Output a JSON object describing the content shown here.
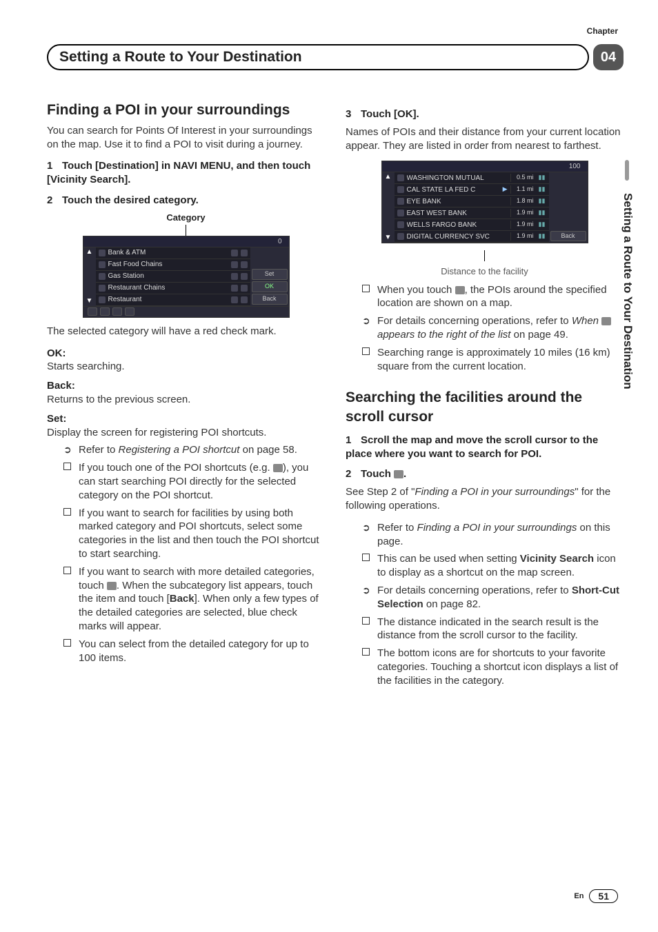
{
  "meta": {
    "chapter_label": "Chapter",
    "chapter_num": "04",
    "header_title": "Setting a Route to Your Destination",
    "side_text": "Setting a Route to Your Destination",
    "page_lang": "En",
    "page_num": "51"
  },
  "left": {
    "section_h": "Finding a POI in your surroundings",
    "intro": "You can search for Points Of Interest in your surroundings on the map. Use it to find a POI to visit during a journey.",
    "step1": "Touch [Destination] in NAVI MENU, and then touch [Vicinity Search].",
    "step2": "Touch the desired category.",
    "category_caption": "Category",
    "after_img": "The selected category will have a red check mark.",
    "ok_t": "OK:",
    "ok_b": "Starts searching.",
    "back_t": "Back:",
    "back_b": "Returns to the previous screen.",
    "set_t": "Set:",
    "set_b": "Display the screen for registering POI shortcuts.",
    "b_refer_pre": "Refer to ",
    "b_refer_em": "Registering a POI shortcut",
    "b_refer_post": " on page 58.",
    "b_ifshort": "If you touch one of the POI shortcuts (e.g. ",
    "b_ifshort2": "), you can start searching POI directly for the selected category on the POI shortcut.",
    "b_both": "If you want to search for facilities by using both marked category and POI shortcuts, select some categories in the list and then touch the POI shortcut to start searching.",
    "b_detail1": "If you want to search with more detailed categories, touch ",
    "b_detail2": ". When the subcategory list appears, touch the item and touch [",
    "b_detail_back": "Back",
    "b_detail3": "]. When only a few types of the detailed categories are selected, blue check marks will appear.",
    "b_100": "You can select from the detailed category for up to 100 items."
  },
  "right": {
    "step3": "Touch [OK].",
    "step3_body": "Names of POIs and their distance from your current location appear. They are listed in order from nearest to farthest.",
    "dist_caption": "Distance to the facility",
    "b_poi_map1": "When you touch ",
    "b_poi_map2": ", the POIs around the specified location are shown on a map.",
    "b_ops1": "For details concerning operations, refer to ",
    "b_ops_em": "When ",
    "b_ops_em2": " appears to the right of the list",
    "b_ops2": " on page 49.",
    "b_range": "Searching range is approximately 10 miles (16 km) square from the current location.",
    "section2_h": "Searching the facilities around the scroll cursor",
    "s2_step1": "Scroll the map and move the scroll cursor to the place where you want to search for POI.",
    "s2_step2": "Touch ",
    "s2_step2_post": ".",
    "s2_see1": "See Step 2 of \"",
    "s2_see_em": "Finding a POI in your surroundings",
    "s2_see2": "\" for the following operations.",
    "s2_b_refer_pre": "Refer to ",
    "s2_b_refer_em": "Finding a POI in your surroundings",
    "s2_b_refer_post": " on this page.",
    "s2_b_vic1": "This can be used when setting ",
    "s2_b_vic_b": "Vicinity Search",
    "s2_b_vic2": " icon to display as a shortcut on the map screen.",
    "s2_b_short1": "For details concerning operations, refer to ",
    "s2_b_short_b": "Short-Cut Selection",
    "s2_b_short2": " on page 82.",
    "s2_b_dist": "The distance indicated in the search result is the distance from the scroll cursor to the facility.",
    "s2_b_icons": "The bottom icons are for shortcuts to your favorite categories. Touching a shortcut icon displays a list of the facilities in the category."
  },
  "ui_cat": {
    "count": "0",
    "rows": [
      {
        "name": "Bank & ATM"
      },
      {
        "name": "Fast Food Chains"
      },
      {
        "name": "Gas Station"
      },
      {
        "name": "Restaurant Chains"
      },
      {
        "name": "Restaurant"
      }
    ],
    "btn_set": "Set",
    "btn_ok": "OK",
    "btn_back": "Back"
  },
  "ui_poi": {
    "count": "100",
    "rows": [
      {
        "name": "WASHINGTON MUTUAL",
        "dist": "0.5 mi"
      },
      {
        "name": "CAL STATE LA FED C",
        "dist": "1.1 mi"
      },
      {
        "name": "EYE BANK",
        "dist": "1.8 mi"
      },
      {
        "name": "EAST WEST BANK",
        "dist": "1.9 mi"
      },
      {
        "name": "WELLS FARGO BANK",
        "dist": "1.9 mi"
      },
      {
        "name": "DIGITAL CURRENCY SVC",
        "dist": "1.9 mi"
      }
    ],
    "btn_back": "Back"
  }
}
